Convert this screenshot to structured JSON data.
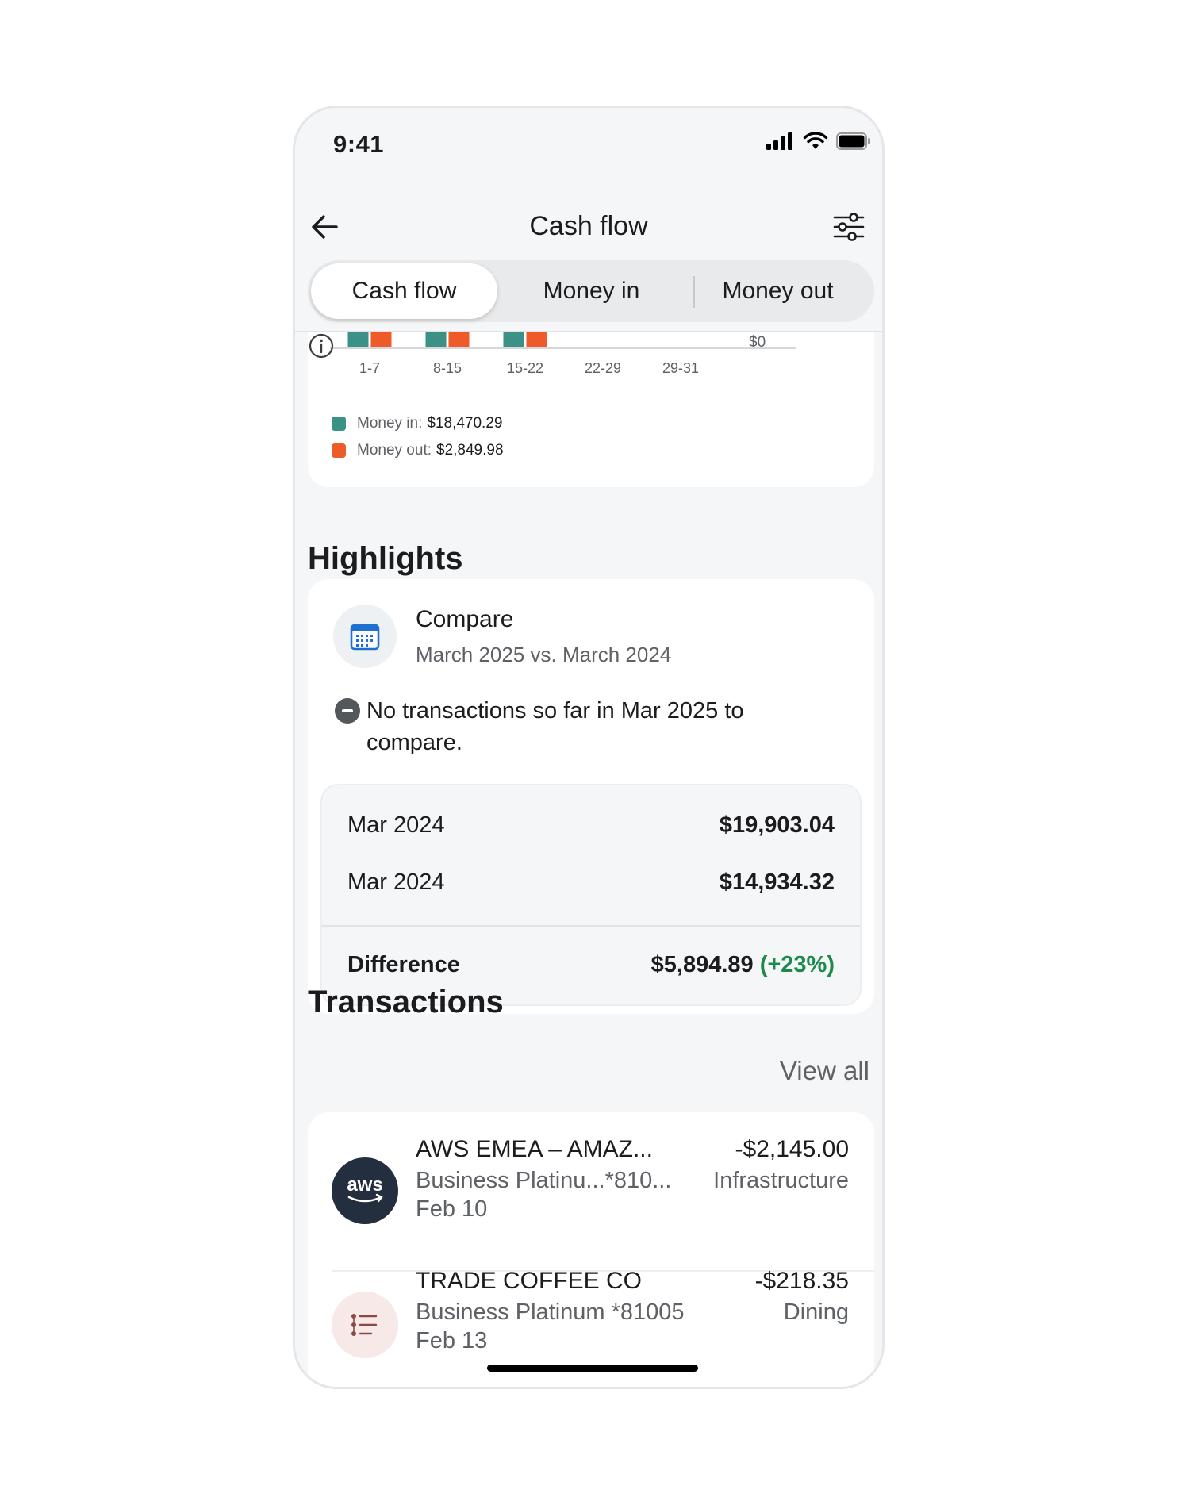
{
  "status": {
    "time": "9:41"
  },
  "nav": {
    "title": "Cash flow"
  },
  "tabs": [
    {
      "label": "Cash flow",
      "active": true
    },
    {
      "label": "Money in",
      "active": false
    },
    {
      "label": "Money out",
      "active": false
    }
  ],
  "chart_data": {
    "type": "bar",
    "categories": [
      "1-7",
      "8-15",
      "15-22",
      "22-29",
      "29-31"
    ],
    "series": [
      {
        "name": "Money in",
        "color": "#3b9186"
      },
      {
        "name": "Money out",
        "color": "#ee5a2a"
      }
    ],
    "ytick_label_visible": "$0",
    "legend": [
      {
        "label": "Money in:",
        "value": "$18,470.29",
        "color": "#3b9186"
      },
      {
        "label": "Money out:",
        "value": "$2,849.98",
        "color": "#ee5a2a"
      }
    ]
  },
  "highlights": {
    "heading": "Highlights",
    "compare_title": "Compare",
    "compare_subtitle": "March 2025 vs. March 2024",
    "message": "No transactions so far in Mar 2025 to compare.",
    "rows": [
      {
        "label": "Mar 2024",
        "amount": "$19,903.04"
      },
      {
        "label": "Mar 2024",
        "amount": "$14,934.32"
      }
    ],
    "difference_label": "Difference",
    "difference_amount": "$5,894.89",
    "difference_pct": "(+23%)",
    "positive_color": "#1b8a4a"
  },
  "transactions": {
    "heading": "Transactions",
    "view_all": "View all",
    "items": [
      {
        "logo_text": "aws",
        "name": "AWS EMEA – AMAZ...",
        "account": "Business Platinu...*810...",
        "date": "Feb 10",
        "amount": "-$2,145.00",
        "category": "Infrastructure"
      },
      {
        "logo_text": "",
        "name": "TRADE COFFEE CO",
        "account": "Business Platinum *81005",
        "date": "Feb 13",
        "amount": "-$218.35",
        "category": "Dining"
      }
    ]
  }
}
